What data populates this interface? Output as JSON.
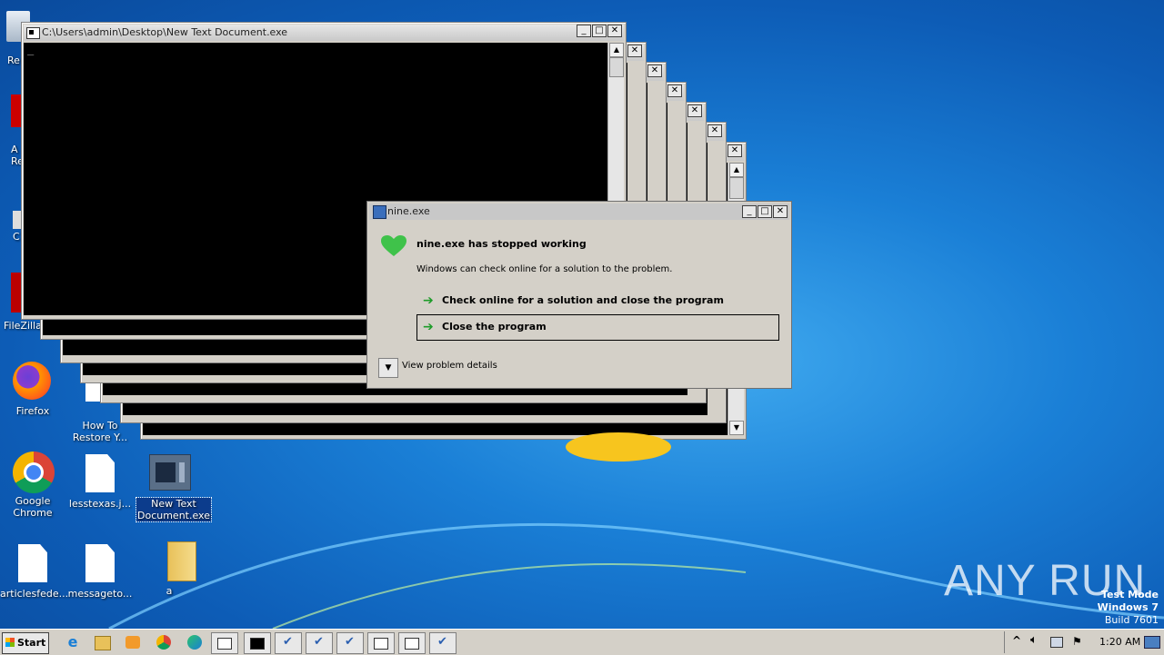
{
  "desktop": {
    "icons": [
      {
        "label": "Re",
        "name": "recycle-bin-icon"
      },
      {
        "label": "A\nRe",
        "name": "acrobat-icon"
      },
      {
        "label": "C",
        "name": "ccleaner-icon"
      },
      {
        "label": "FileZilla C",
        "name": "filezilla-icon"
      },
      {
        "label": "Firefox",
        "name": "firefox-icon"
      },
      {
        "label": "How To\nRestore Y...",
        "name": "how-to-restore-icon"
      },
      {
        "label": "Google\nChrome",
        "name": "chrome-icon"
      },
      {
        "label": "lesstexas.j...",
        "name": "lesstexas-file-icon"
      },
      {
        "label": "New Text\nDocument.exe",
        "name": "new-text-document-exe-icon"
      },
      {
        "label": "articlesfede...",
        "name": "articlesfede-file-icon"
      },
      {
        "label": "messageto...",
        "name": "messageto-file-icon"
      },
      {
        "label": "a",
        "name": "folder-a-icon"
      }
    ],
    "watermark": "ANY RUN",
    "test_mode": {
      "line1": "Test Mode",
      "line2": "Windows 7",
      "line3": "Build 7601"
    }
  },
  "console_window": {
    "title": "C:\\Users\\admin\\Desktop\\New Text Document.exe",
    "cursor": "_"
  },
  "dialog": {
    "title": "nine.exe",
    "heading": "nine.exe has stopped working",
    "description": "Windows can check online for a solution to the problem.",
    "option_check": "Check online for a solution and close the program",
    "option_close": "Close the program",
    "details": "View problem details"
  },
  "window_controls": {
    "minimize": "_",
    "maximize": "□",
    "close": "✕"
  },
  "taskbar": {
    "start_label": "Start",
    "clock": "1:20 AM",
    "tray_up": "^"
  }
}
